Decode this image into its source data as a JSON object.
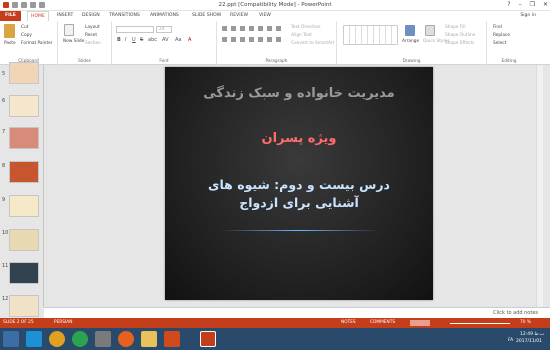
{
  "titlebar": {
    "title": "22.ppt [Compatibility Mode] - PowerPoint",
    "help": "?",
    "minimize": "–",
    "restore": "❐",
    "close": "✕"
  },
  "tabs": [
    "FILE",
    "HOME",
    "INSERT",
    "DESIGN",
    "TRANSITIONS",
    "ANIMATIONS",
    "SLIDE SHOW",
    "REVIEW",
    "VIEW"
  ],
  "active_tab": "HOME",
  "signin": "Sign in",
  "ribbon": {
    "clipboard": {
      "paste": "Paste",
      "cut": "Cut",
      "copy": "Copy",
      "format_painter": "Format Painter",
      "label": "Clipboard"
    },
    "slides": {
      "new_slide": "New Slide",
      "layout": "Layout",
      "reset": "Reset",
      "section": "Section",
      "label": "Slides"
    },
    "font": {
      "size": "24",
      "label": "Font",
      "bold": "B",
      "italic": "I",
      "underline": "U",
      "strike": "S",
      "shadow": "abc",
      "spacing": "AV",
      "case": "Aa",
      "color": "A"
    },
    "paragraph": {
      "text_direction": "Text Direction",
      "align_text": "Align Text",
      "convert_smartart": "Convert to SmartArt",
      "label": "Paragraph"
    },
    "drawing": {
      "arrange": "Arrange",
      "quick_styles": "Quick Styles",
      "shape_fill": "Shape Fill",
      "shape_outline": "Shape Outline",
      "shape_effects": "Shape Effects",
      "label": "Drawing"
    },
    "editing": {
      "find": "Find",
      "replace": "Replace",
      "select": "Select",
      "label": "Editing"
    }
  },
  "thumbnails": [
    {
      "num": "5"
    },
    {
      "num": "6"
    },
    {
      "num": "7"
    },
    {
      "num": "8"
    },
    {
      "num": "9"
    },
    {
      "num": "10"
    },
    {
      "num": "11"
    },
    {
      "num": "12"
    }
  ],
  "slide": {
    "line1": "مدیریت خانواده و سبک زندگی",
    "line2": "ویژه پسران",
    "line3": "درس بیست و دوم: شیوه های آشنایی برای ازدواج"
  },
  "notes_placeholder": "Click to add notes",
  "statusbar": {
    "slide_of": "SLIDE 2 OF 25",
    "language": "PERSIAN",
    "notes": "NOTES",
    "comments": "COMMENTS",
    "zoom": "70 %"
  },
  "tray": {
    "lang": "FA",
    "time": "12:49 ب.ظ",
    "date": "2017/11/01"
  },
  "colors": {
    "accent": "#c43e1c",
    "taskbar": "#2a4a6b"
  }
}
